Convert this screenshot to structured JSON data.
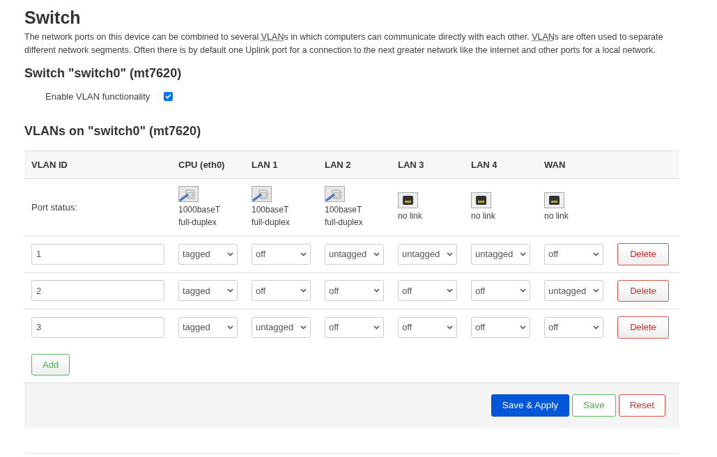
{
  "title": "Switch",
  "description": [
    {
      "text": "The network ports on this device can be combined to several ",
      "abbr": false
    },
    {
      "text": "VLAN",
      "abbr": true
    },
    {
      "text": "s in which computers can communicate directly with each other. ",
      "abbr": false
    },
    {
      "text": "VLAN",
      "abbr": true
    },
    {
      "text": "s are often used to separate different network segments. Often there is by default one Uplink port for a connection to the next greater network like the internet and other ports for a local network.",
      "abbr": false
    }
  ],
  "switch_section": {
    "title": "Switch \"switch0\" (mt7620)",
    "enable_vlan": {
      "label": "Enable VLAN functionality",
      "checked": true
    }
  },
  "vlan_section": {
    "title": "VLANs on \"switch0\" (mt7620)",
    "table": {
      "columns": [
        "VLAN ID",
        "CPU (eth0)",
        "LAN 1",
        "LAN 2",
        "LAN 3",
        "LAN 4",
        "WAN"
      ],
      "port_status_label": "Port status:",
      "port_status": [
        {
          "link": true,
          "speed": "1000baseT",
          "duplex": "full-duplex"
        },
        {
          "link": true,
          "speed": "100baseT",
          "duplex": "full-duplex"
        },
        {
          "link": true,
          "speed": "100baseT",
          "duplex": "full-duplex"
        },
        {
          "link": false,
          "speed": "no link"
        },
        {
          "link": false,
          "speed": "no link"
        },
        {
          "link": false,
          "speed": "no link"
        }
      ],
      "rows": [
        {
          "vlan_id": "1",
          "ports": [
            "tagged",
            "off",
            "untagged",
            "untagged",
            "untagged",
            "off"
          ],
          "delete": "Delete"
        },
        {
          "vlan_id": "2",
          "ports": [
            "tagged",
            "off",
            "off",
            "off",
            "off",
            "untagged"
          ],
          "delete": "Delete"
        },
        {
          "vlan_id": "3",
          "ports": [
            "tagged",
            "untagged",
            "off",
            "off",
            "off",
            "off"
          ],
          "delete": "Delete"
        }
      ]
    },
    "add_button": "Add"
  },
  "actions": [
    {
      "label": "Save & Apply",
      "kind": "primary"
    },
    {
      "label": "Save",
      "kind": "positive"
    },
    {
      "label": "Reset",
      "kind": "negative"
    }
  ]
}
